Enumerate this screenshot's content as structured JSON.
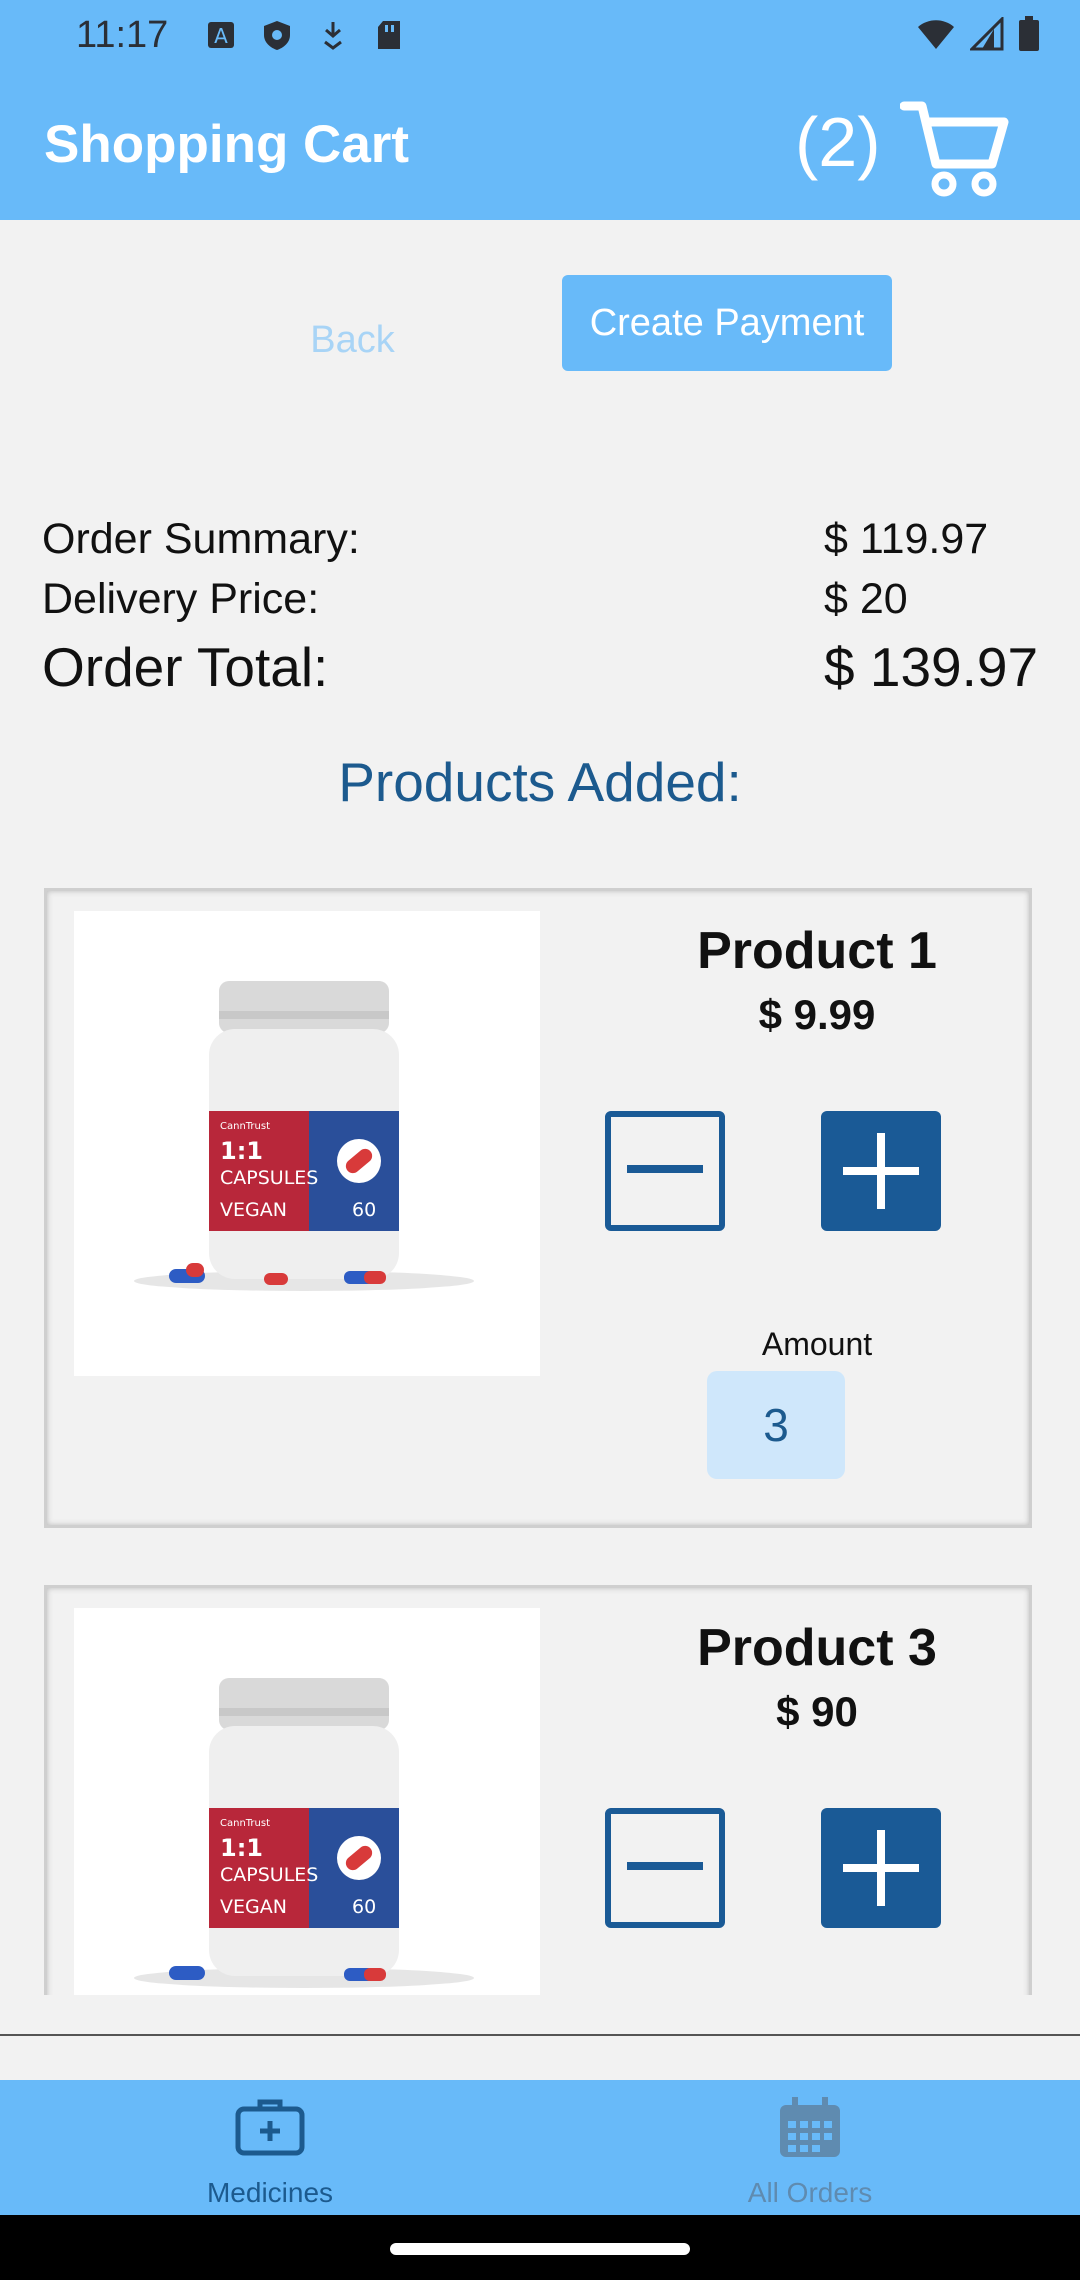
{
  "status_bar": {
    "time": "11:17"
  },
  "app_bar": {
    "title": "Shopping Cart",
    "cart_count": "(2)"
  },
  "actions": {
    "back_label": "Back",
    "create_payment_label": "Create Payment"
  },
  "summary": {
    "order_summary_label": "Order Summary:",
    "order_summary_value": "$ 119.97",
    "delivery_label": "Delivery Price:",
    "delivery_value": "$ 20",
    "total_label": "Order Total:",
    "total_value": "$ 139.97"
  },
  "products_heading": "Products Added:",
  "products": [
    {
      "name": "Product 1",
      "price": "$ 9.99",
      "amount_label": "Amount",
      "amount": "3"
    },
    {
      "name": "Product 3",
      "price": "$ 90"
    }
  ],
  "product_image_text": {
    "brand": "CannTrust",
    "ratio": "1:1",
    "kind": "CAPSULES",
    "vegan": "VEGAN",
    "count": "60"
  },
  "bottom_nav": [
    {
      "label": "Medicines",
      "icon": "medical-kit-icon",
      "active": true
    },
    {
      "label": "All Orders",
      "icon": "calendar-icon",
      "active": false
    }
  ],
  "colors": {
    "primary": "#68baf9",
    "dark_blue": "#1a5a96",
    "text_blue": "#1c5a8e"
  }
}
